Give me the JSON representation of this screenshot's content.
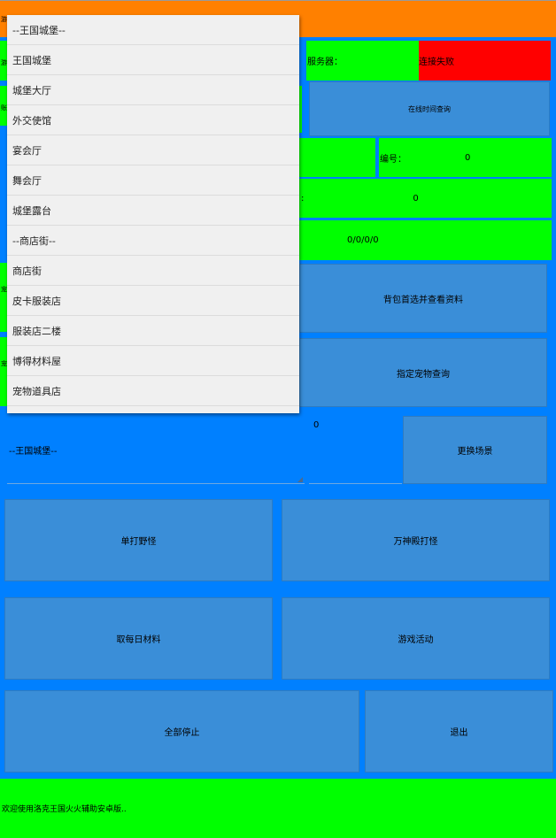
{
  "topbar": {
    "left_fragment": "游"
  },
  "row1": {
    "left_fragment": "游",
    "server_label": "服务器：",
    "server_status": "连接失败"
  },
  "row2": {
    "left_fragment": "账",
    "online_query": "在线时间查询"
  },
  "row3": {
    "number_label": "编号：",
    "number_value": "0"
  },
  "row4": {
    "colon": ":",
    "value": "0"
  },
  "row5": {
    "value": "0/0/0/0"
  },
  "row6": {
    "left_fragment": "宠",
    "bag_button": "背包首选并查看资料"
  },
  "row7": {
    "left_fragment": "宠",
    "pet_query_button": "指定宠物查询"
  },
  "scene": {
    "selected": "--王国城堡--",
    "count": "0",
    "change_button": "更换场景"
  },
  "buttons": {
    "solo_wild": "单打野怪",
    "pantheon": "万神殿打怪",
    "daily_materials": "取每日材料",
    "game_events": "游戏活动",
    "stop_all": "全部停止",
    "exit": "退出"
  },
  "status_bar": {
    "message": "欢迎使用洛克王国火火辅助安卓版.."
  },
  "dropdown": {
    "items": [
      "--王国城堡--",
      "王国城堡",
      "城堡大厅",
      "外交使馆",
      "宴会厅",
      "舞会厅",
      "城堡露台",
      "--商店街--",
      "商店街",
      "皮卡服装店",
      "服装店二楼",
      "博得材料屋",
      "宠物道具店"
    ]
  },
  "colors": {
    "accent_blue": "#0080ff",
    "button_blue": "#3a8ed8",
    "ok_green": "#00ff00",
    "error_red": "#ff0000",
    "top_orange": "#ff8000"
  }
}
